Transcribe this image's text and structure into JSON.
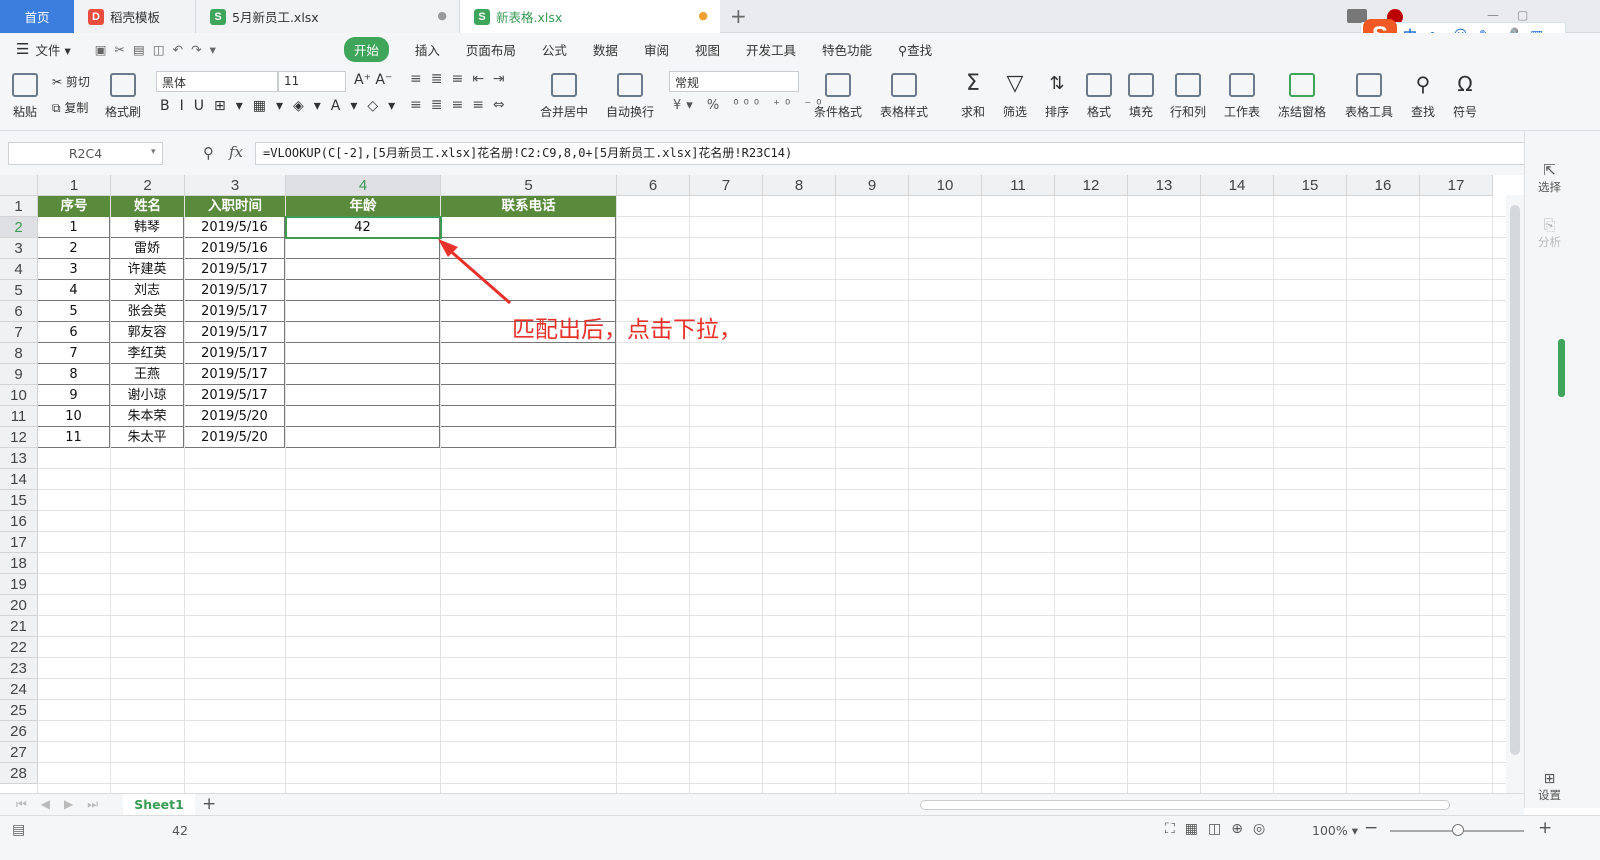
{
  "tabs": {
    "home": "首页",
    "t1": "稻壳模板",
    "t2": "5月新员工.xlsx",
    "t3": "新表格.xlsx",
    "add": "+"
  },
  "menu": {
    "file": "文件",
    "items": [
      "开始",
      "插入",
      "页面布局",
      "公式",
      "数据",
      "审阅",
      "视图",
      "开发工具",
      "特色功能"
    ],
    "search": "查找"
  },
  "ime": {
    "logo": "S",
    "items": [
      "中",
      "•,",
      "☺",
      "✎",
      "🎤",
      "▦"
    ]
  },
  "ribbon": {
    "paste": "粘贴",
    "cut": "剪切",
    "copy": "复制",
    "format_painter": "格式刷",
    "font_name": "黑体",
    "font_size": "11",
    "number_format": "常规",
    "merge": "合并居中",
    "wrap": "自动换行",
    "cond_format": "条件格式",
    "table_style": "表格样式",
    "sum": "求和",
    "filter": "筛选",
    "sort": "排序",
    "format": "格式",
    "fill": "填充",
    "rowcol": "行和列",
    "worksheet": "工作表",
    "freeze": "冻结窗格",
    "table_tools": "表格工具",
    "find": "查找",
    "symbol": "符号"
  },
  "formula_bar": {
    "name_box": "R2C4",
    "fx": "fx",
    "formula": "=VLOOKUP(C[-2],[5月新员工.xlsx]花名册!C2:C9,8,0+[5月新员工.xlsx]花名册!R23C14)"
  },
  "grid": {
    "col_headers": [
      "1",
      "2",
      "3",
      "4",
      "5",
      "6",
      "7",
      "8",
      "9",
      "10",
      "11",
      "12",
      "13",
      "14",
      "15",
      "16",
      "17"
    ],
    "row_headers": [
      "1",
      "2",
      "3",
      "4",
      "5",
      "6",
      "7",
      "8",
      "9",
      "10",
      "11",
      "12",
      "13",
      "14",
      "15",
      "16",
      "17",
      "18",
      "19",
      "20",
      "21",
      "22",
      "23",
      "24",
      "25",
      "26",
      "27",
      "28"
    ],
    "header": [
      "序号",
      "姓名",
      "入职时间",
      "年龄",
      "联系电话"
    ],
    "rows": [
      [
        "1",
        "韩琴",
        "2019/5/16",
        "42",
        ""
      ],
      [
        "2",
        "雷娇",
        "2019/5/16",
        "",
        ""
      ],
      [
        "3",
        "许建英",
        "2019/5/17",
        "",
        ""
      ],
      [
        "4",
        "刘志",
        "2019/5/17",
        "",
        ""
      ],
      [
        "5",
        "张会英",
        "2019/5/17",
        "",
        ""
      ],
      [
        "6",
        "郭友容",
        "2019/5/17",
        "",
        ""
      ],
      [
        "7",
        "李红英",
        "2019/5/17",
        "",
        ""
      ],
      [
        "8",
        "王燕",
        "2019/5/17",
        "",
        ""
      ],
      [
        "9",
        "谢小琼",
        "2019/5/17",
        "",
        ""
      ],
      [
        "10",
        "朱本荣",
        "2019/5/20",
        "",
        ""
      ],
      [
        "11",
        "朱太平",
        "2019/5/20",
        "",
        ""
      ]
    ]
  },
  "annotation": "匹配出后，点击下拉，",
  "right_panel": {
    "select": "选择",
    "analyze": "分析",
    "settings": "设置"
  },
  "sheet": {
    "name": "Sheet1",
    "add": "+"
  },
  "status": {
    "value": "42",
    "zoom": "100%"
  },
  "colors": {
    "accent": "#3fa55b",
    "header_fill": "#5a8a3c",
    "annotation": "#e8312a",
    "home_tab": "#3b7ede"
  }
}
